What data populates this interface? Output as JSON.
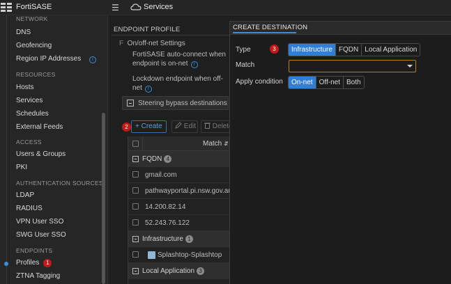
{
  "app": {
    "brand": "FortiSASE",
    "breadcrumb": "Services"
  },
  "sidebar": {
    "cut_section": "NETWORK",
    "items_top": [
      {
        "label": "DNS"
      },
      {
        "label": "Geofencing"
      },
      {
        "label": "Region IP Addresses"
      }
    ],
    "resources_section": "RESOURCES",
    "resources": [
      {
        "label": "Hosts"
      },
      {
        "label": "Services"
      },
      {
        "label": "Schedules"
      },
      {
        "label": "External Feeds"
      }
    ],
    "access_section": "ACCESS",
    "access": [
      {
        "label": "Users & Groups"
      },
      {
        "label": "PKI"
      }
    ],
    "auth_section": "AUTHENTICATION SOURCES",
    "auth": [
      {
        "label": "LDAP"
      },
      {
        "label": "RADIUS"
      },
      {
        "label": "VPN User SSO"
      },
      {
        "label": "SWG User SSO"
      }
    ],
    "endpoints_section": "ENDPOINTS",
    "endpoints": [
      {
        "label": "Profiles",
        "badge": "1"
      },
      {
        "label": "ZTNA Tagging"
      }
    ]
  },
  "page": {
    "title": "ENDPOINT PROFILE",
    "onoff_label": "On/off-net Settings",
    "auto_connect": "FortiSASE auto-connect when",
    "auto_connect_2": "endpoint is on-net",
    "lockdown": "Lockdown endpoint when off-",
    "lockdown_2": "net",
    "steering": "Steering bypass destinations",
    "create_badge": "2",
    "toolbar": {
      "create": "+ Create",
      "edit": "Edit",
      "delete": "Delete"
    },
    "table": {
      "col_match": "Match",
      "groups": [
        {
          "name": "FQDN",
          "count": "4",
          "rows": [
            "gmail.com",
            "pathwayportal.pi.nsw.gov.au",
            "14.200.82.14",
            "52.243.76.122"
          ]
        },
        {
          "name": "Infrastructure",
          "count": "1",
          "rows": [
            "Splashtop-Splashtop"
          ]
        },
        {
          "name": "Local Application",
          "count": "3",
          "rows": []
        }
      ]
    }
  },
  "modal": {
    "title": "CREATE DESTINATION",
    "type_label": "Type",
    "type_badge": "3",
    "type_options": [
      "Infrastructure",
      "FQDN",
      "Local Application"
    ],
    "type_selected": "Infrastructure",
    "match_label": "Match",
    "match_value": "",
    "apply_label": "Apply condition",
    "apply_options": [
      "On-net",
      "Off-net",
      "Both"
    ],
    "apply_selected": "On-net"
  },
  "colors": {
    "accent": "#2f7ed8",
    "badge": "#c21a1a",
    "highlight_border": "#b5821f"
  },
  "icons": [
    "fortinet-logo-icon",
    "hamburger-icon",
    "cloud-icon",
    "info-icon",
    "edit-icon",
    "trash-icon",
    "sort-icon",
    "caret-down-icon"
  ]
}
